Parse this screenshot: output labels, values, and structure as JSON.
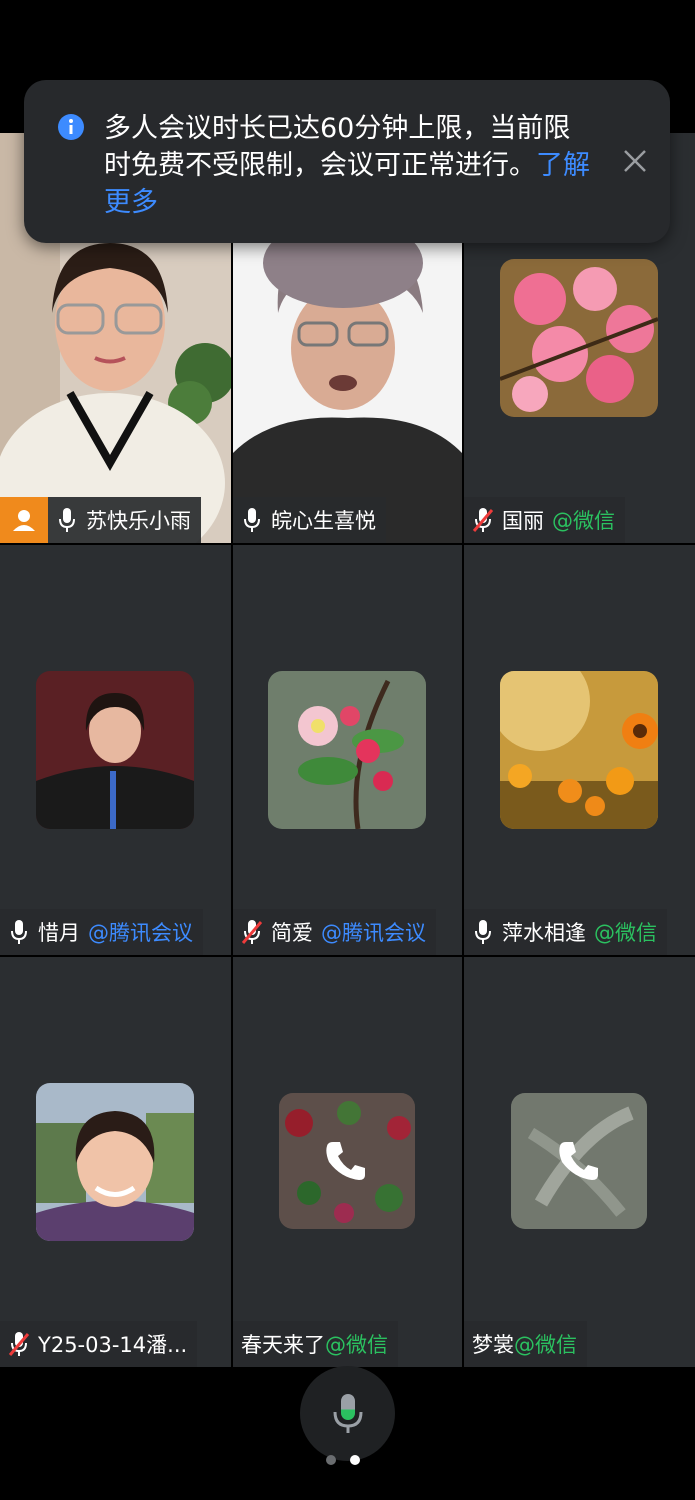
{
  "toast": {
    "message": "多人会议时长已达60分钟上限，当前限时免费不受限制，会议可正常进行。",
    "link_label": "了解更多"
  },
  "participants": [
    {
      "name": "苏快乐小雨",
      "source": "",
      "mic": "on",
      "host": true,
      "video": true
    },
    {
      "name": "皖心生喜悦",
      "source": "",
      "mic": "on",
      "host": false,
      "video": true,
      "active_speaker": true
    },
    {
      "name": "国丽",
      "source": "@微信",
      "mic": "muted",
      "avatar": "pink-blossom"
    },
    {
      "name": "惜月",
      "source": "@腾讯会议",
      "mic": "on",
      "avatar": "woman-portrait"
    },
    {
      "name": "简爱",
      "source": "@腾讯会议",
      "mic": "muted",
      "avatar": "pink-flower"
    },
    {
      "name": "萍水相逢",
      "source": "@微信",
      "mic": "on",
      "avatar": "sunflowers"
    },
    {
      "name": "Y25-03-14潘...",
      "source": "",
      "mic": "muted",
      "avatar": "woman-smiling"
    },
    {
      "name": "春天来了",
      "source": "@微信",
      "mic": "none",
      "avatar": "flower-collage",
      "phone": true
    },
    {
      "name": "梦裳",
      "source": "@微信",
      "mic": "none",
      "avatar": "white-lily",
      "phone": true
    }
  ],
  "colors": {
    "tile_bg": "#2b2e31",
    "active_border": "#2bb55c",
    "wechat": "#2bc160",
    "tencent_meeting": "#3d8bff",
    "host_badge": "#f08a1c"
  },
  "pagination": {
    "pages": 2,
    "current": 2
  }
}
